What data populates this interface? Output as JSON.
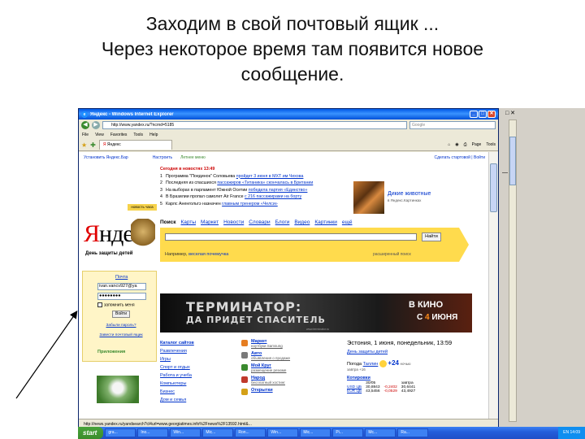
{
  "caption": {
    "line1": "Заходим в свой почтовый ящик ...",
    "line2": "Через некоторое время там появится новое",
    "line3": "сообщение."
  },
  "window": {
    "title": "Яндекс - Windows Internet Explorer",
    "address": "http://www.yandex.ru/?ncrnd=5185",
    "search_placeholder": "Google",
    "menu": [
      "File",
      "View",
      "Favorites",
      "Tools",
      "Help"
    ],
    "tab_label": "Яндекс",
    "toolbar_items": [
      "Page",
      "Tools"
    ],
    "status_text": "http://news.yandex.ru/yandsearch?cl4url=www.georgiatimes.info%2Fnews%2F13592.html&..."
  },
  "page": {
    "top_link_left": "Установить Яндекс.Бар",
    "top_link_mid": "Настроить",
    "top_link_mid2": "Летнее меню",
    "top_link_right": "Сделать стартовой | Войти",
    "news_header": "Сегодня в новостях",
    "news_time": "13:49",
    "hot_label": "новость часа",
    "news": [
      {
        "num": "1",
        "text": "Программа \"Поединок\" Соловьева ",
        "link": "пройдет 3 июня в МХТ им Чехова"
      },
      {
        "num": "2",
        "text": "Последняя из спасшихся ",
        "link": "пассажиров «Титаника» скончалась в Британии"
      },
      {
        "num": "3",
        "text": "На выборах в парламент Южной Осетии ",
        "link": "победила партия «Единство»"
      },
      {
        "num": "4",
        "text": "В Бразилии пропал самолет Air France ",
        "link": "с 216 пассажирами на борту"
      },
      {
        "num": "5",
        "text": "Карлс Аненгольтэ назначен ",
        "link": "главным тренером «Челси»"
      }
    ],
    "promo_title": "Дикие животные",
    "promo_sub": "в Яндекс.Картинках",
    "logo_ya": "Я",
    "logo_rest": "ндекс",
    "logo_sub": "День защиты детей",
    "search_tabs": [
      "Поиск",
      "Карты",
      "Маркет",
      "Новости",
      "Словари",
      "Блоги",
      "Видео",
      "Картинки",
      "ещё"
    ],
    "search_button": "Найти",
    "search_hint_prefix": "Например, ",
    "search_hint_query": "веселая почемучка",
    "search_advanced": "расширенный поиск",
    "mail": {
      "header": "Почта",
      "login": "ivan.vancv927@ya",
      "password": "●●●●●●●●",
      "remember": "запомнить меня",
      "enter": "Войти",
      "forgot": "Забыли пароль?",
      "register": "Завести почтовый ящик",
      "apps": "Приложения"
    },
    "banner": {
      "line1": "ТЕРМИНАТОР:",
      "line2": "ДА ПРИДЕТ СПАСИТЕЛЬ",
      "cinema": "В КИНО",
      "date_prefix": "С ",
      "date_num": "4",
      "date_suffix": " ИЮНЯ",
      "fine": "www.terminator.ru"
    },
    "catalog": {
      "header": "Каталог сайтов",
      "items": [
        "Развлечения",
        "Игры",
        "Спорт и отдых",
        "Работа и учеба",
        "Компьютеры",
        "Бизнес",
        "Дом и семья"
      ]
    },
    "services": [
      {
        "name": "Маркет",
        "desc": "ноутбуки Samsung",
        "color": "#e67e22"
      },
      {
        "name": "Авто",
        "desc": "объявления о продаже",
        "color": "#7a7a7a"
      },
      {
        "name": "Мой Круг",
        "desc": "размещение резюме",
        "color": "#3a8a2e"
      },
      {
        "name": "Народ",
        "desc": "бесплатный хостинг",
        "color": "#c0392b"
      },
      {
        "name": "Открытки",
        "desc": "",
        "color": "#d4a017"
      }
    ],
    "info": {
      "date": "Эстония, 1 июня, понедельник, 13:59",
      "holiday": "День защиты детей",
      "weather_label": "Погода",
      "weather_city": "Таллин",
      "temp": "+24",
      "weather_day": "ночью",
      "weather_tomorrow": "завтра +16",
      "quotes_header": "Котировки",
      "quotes_cols": [
        "",
        "30/05",
        "завтра"
      ],
      "quotes": [
        [
          "USD ЦБ",
          "30,8843",
          "-0,2402",
          "30,6441"
        ],
        [
          "EUR ЦБ",
          "43,5456",
          "-0,0529",
          "43,4927"
        ]
      ]
    }
  },
  "background": {
    "controls_top": "□ ✕",
    "controls_mid": "— ✕"
  },
  "taskbar": {
    "start": "start",
    "items": [
      "gra...",
      "Ino...",
      "Win...",
      "Mic...",
      "Ron...",
      "Win...",
      "Mic...",
      "Pi...",
      "Mc...",
      "Ra..."
    ],
    "tray": "EN 14:09"
  }
}
